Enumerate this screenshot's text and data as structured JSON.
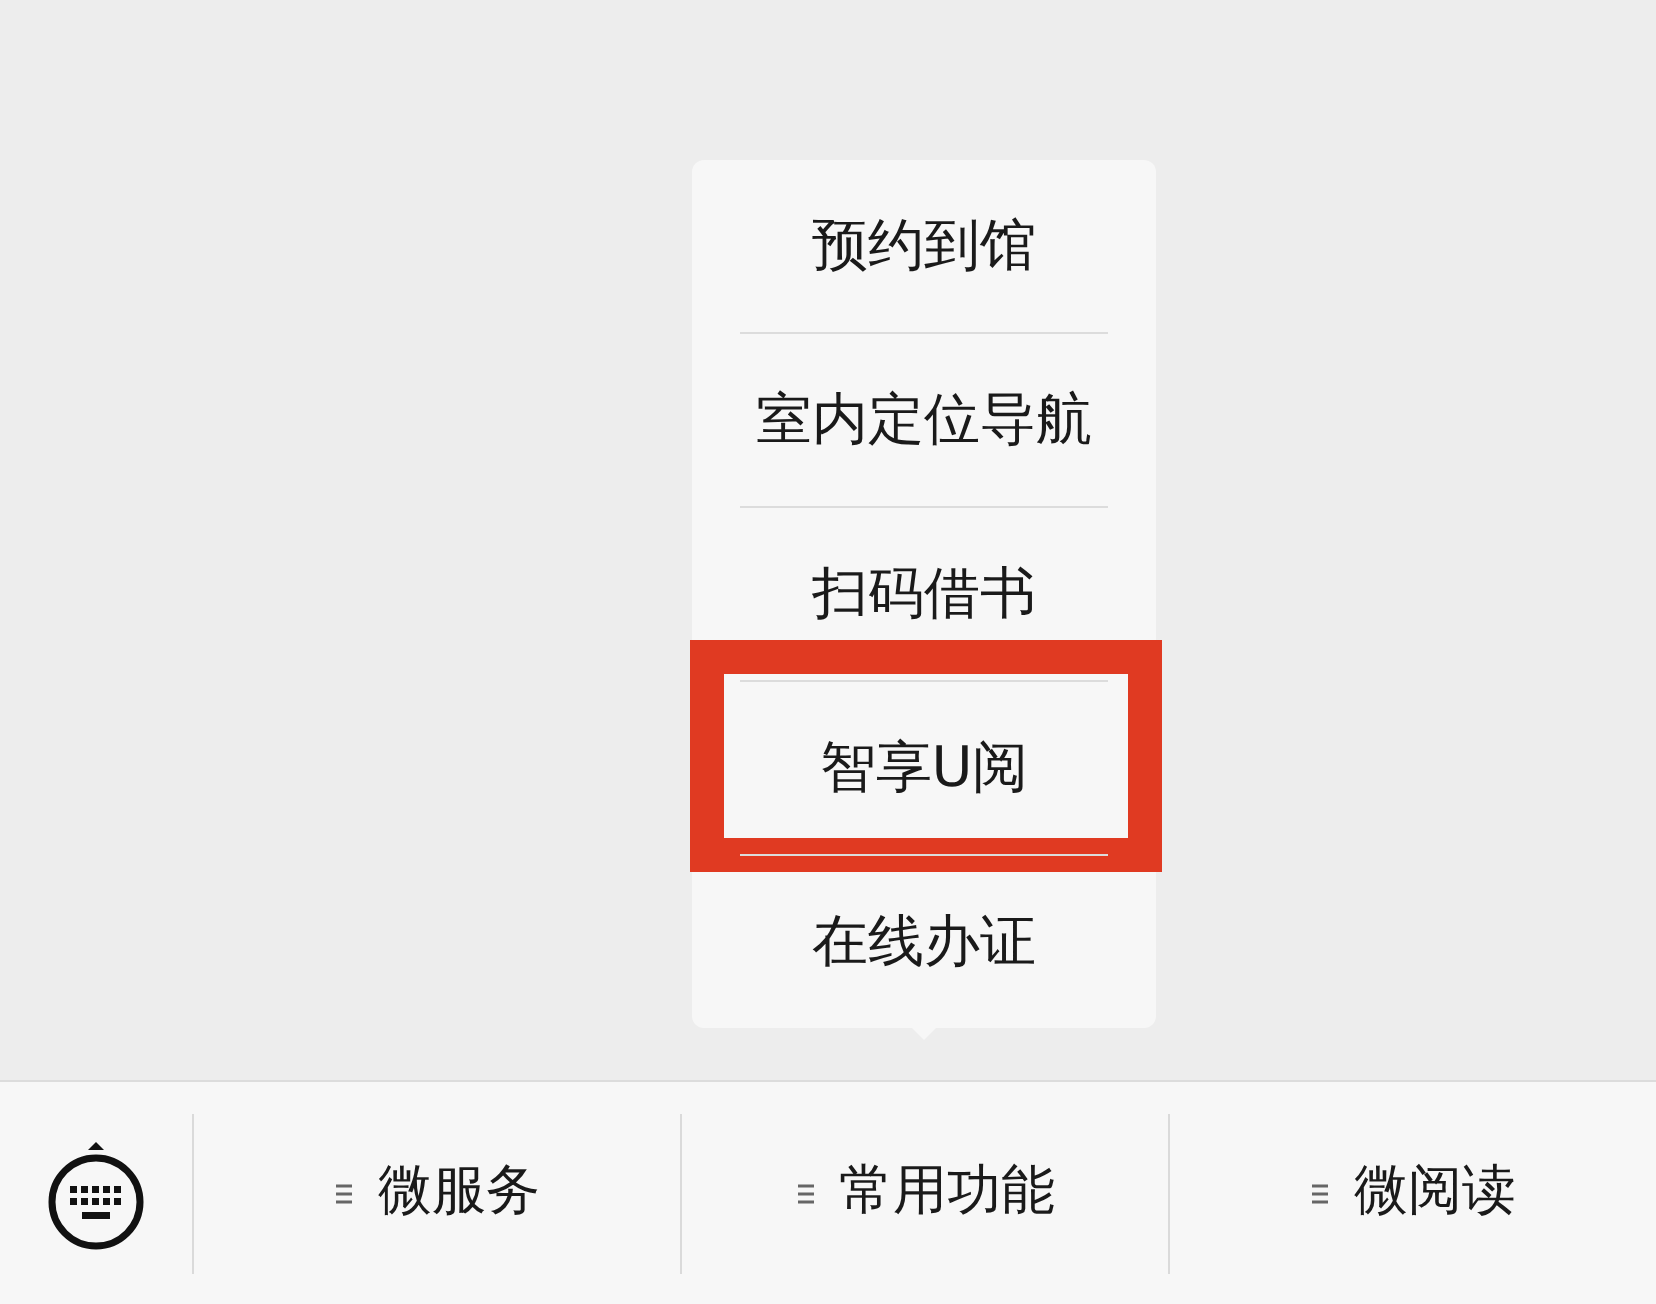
{
  "popup_menu": {
    "items": [
      {
        "label": "预约到馆",
        "highlighted": false
      },
      {
        "label": "室内定位导航",
        "highlighted": false
      },
      {
        "label": "扫码借书",
        "highlighted": false
      },
      {
        "label": "智享U阅",
        "highlighted": true
      },
      {
        "label": "在线办证",
        "highlighted": false
      }
    ]
  },
  "bottom_bar": {
    "menus": [
      {
        "label": "微服务"
      },
      {
        "label": "常用功能"
      },
      {
        "label": "微阅读"
      }
    ]
  }
}
